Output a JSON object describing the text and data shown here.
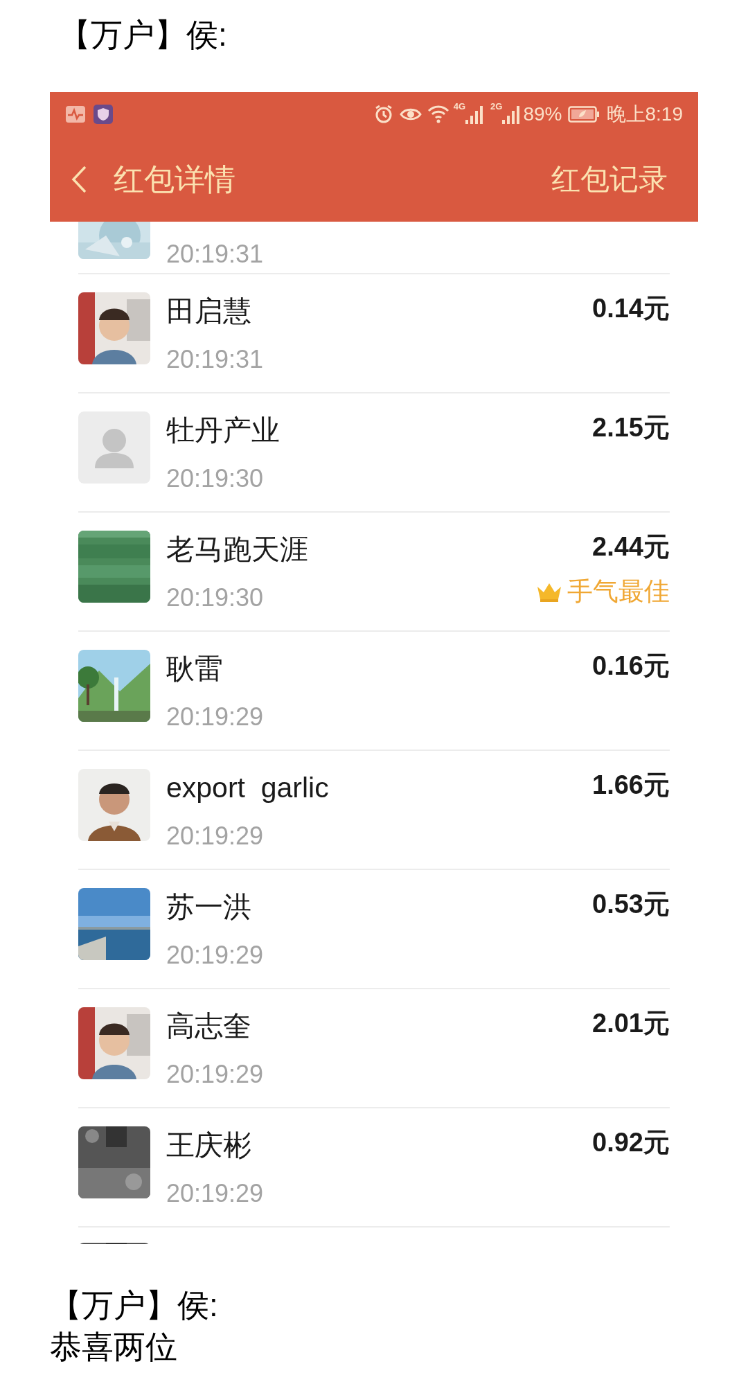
{
  "caption_top": "【万户】侯:",
  "screenshot": {
    "status_bar": {
      "network_1": "4G",
      "network_2": "2G",
      "battery": "89%",
      "time": "晚上8:19"
    },
    "header": {
      "title": "红包详情",
      "action": "红包记录"
    },
    "partial_top": {
      "time": "20:19:31"
    },
    "rows": [
      {
        "name": "田启慧",
        "time": "20:19:31",
        "amount": "0.14元",
        "best": false
      },
      {
        "avatar": {
          "kind": "default"
        },
        "name": "牡丹产业",
        "time": "20:19:30",
        "amount": "2.15元",
        "best": false
      },
      {
        "name": "老马跑天涯",
        "time": "20:19:30",
        "amount": "2.44元",
        "best": true,
        "best_label": "手气最佳"
      },
      {
        "name": "耿雷",
        "time": "20:19:29",
        "amount": "0.16元",
        "best": false
      },
      {
        "name": "export  garlic",
        "time": "20:19:29",
        "amount": "1.66元",
        "best": false
      },
      {
        "name": "苏一洪",
        "time": "20:19:29",
        "amount": "0.53元",
        "best": false
      },
      {
        "name": "高志奎",
        "time": "20:19:29",
        "amount": "2.01元",
        "best": false
      },
      {
        "name": "王庆彬",
        "time": "20:19:29",
        "amount": "0.92元",
        "best": false
      }
    ]
  },
  "messages": [
    {
      "sender": "【万户】侯:",
      "text": "恭喜两位"
    }
  ]
}
